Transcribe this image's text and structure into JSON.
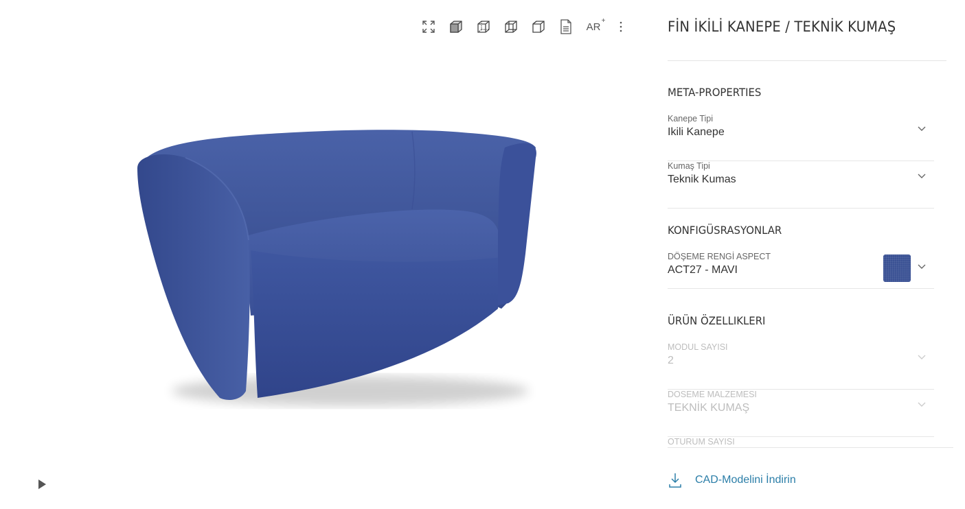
{
  "viewer": {
    "toolbar": [
      {
        "name": "fullscreen-icon",
        "label": ""
      },
      {
        "name": "view-solid-cube-icon",
        "label": ""
      },
      {
        "name": "view-front-cube-icon",
        "label": ""
      },
      {
        "name": "view-side-cube-icon",
        "label": ""
      },
      {
        "name": "view-top-cube-icon",
        "label": ""
      },
      {
        "name": "document-icon",
        "label": ""
      },
      {
        "name": "ar-icon",
        "label": "AR"
      },
      {
        "name": "more-vertical-icon",
        "label": ""
      }
    ],
    "ar_label": "AR",
    "ar_superscript": "+",
    "product_color": "#3a5194",
    "play_icon": "play-icon"
  },
  "panel": {
    "title": "FİN İKİLİ KANEPE / TEKNİK KUMAŞ",
    "sections": {
      "meta": "META-PROPERTIES",
      "config": "KONFIGÜSRASYONLAR",
      "features": "ÜRÜN ÖZELLIKLERI"
    },
    "meta_props": [
      {
        "label": "Kanepe Tipi",
        "value": "Ikili Kanepe"
      },
      {
        "label": "Kumaş Tipi",
        "value": "Teknik Kumas"
      }
    ],
    "config_props": [
      {
        "label": "DÖŞEME RENGİ ASPECT",
        "value": "ACT27 - MAVI",
        "swatch_color": "#3a5194"
      }
    ],
    "feature_props": [
      {
        "label": "MODUL SAYISI",
        "value": "2"
      },
      {
        "label": "DOSEME MALZEMESI",
        "value": "TEKNİK KUMAŞ"
      },
      {
        "label": "OTURUM SAYISI",
        "value": ""
      }
    ],
    "cad_link": "CAD-Modelini İndirin",
    "accent_color": "#2b7ea8"
  }
}
